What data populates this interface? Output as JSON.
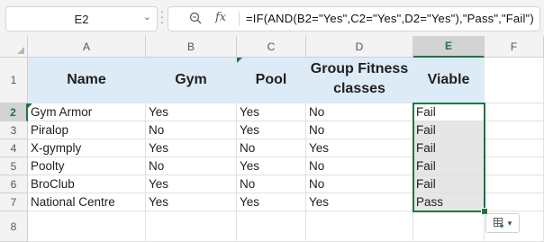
{
  "name_box": {
    "value": "E2"
  },
  "formula_bar": {
    "formula": "=IF(AND(B2=\"Yes\",C2=\"Yes\",D2=\"Yes\"),\"Pass\",\"Fail\")",
    "fx_label": "fx"
  },
  "columns": [
    "A",
    "B",
    "C",
    "D",
    "E",
    "F"
  ],
  "rows": [
    "1",
    "2",
    "3",
    "4",
    "5",
    "6",
    "7",
    "8"
  ],
  "header": {
    "name": "Name",
    "gym": "Gym",
    "pool": "Pool",
    "group": "Group Fitness classes",
    "viable": "Viable"
  },
  "data_rows": [
    {
      "name": "Gym Armor",
      "gym": "Yes",
      "pool": "Yes",
      "group": "No",
      "viable": "Fail"
    },
    {
      "name": "Piralop",
      "gym": "No",
      "pool": "Yes",
      "group": "No",
      "viable": "Fail"
    },
    {
      "name": "X-gymply",
      "gym": "Yes",
      "pool": "No",
      "group": "Yes",
      "viable": "Fail"
    },
    {
      "name": "Poolty",
      "gym": "No",
      "pool": "Yes",
      "group": "No",
      "viable": "Fail"
    },
    {
      "name": "BroClub",
      "gym": "Yes",
      "pool": "No",
      "group": "No",
      "viable": "Fail"
    },
    {
      "name": "National Centre",
      "gym": "Yes",
      "pool": "Yes",
      "group": "Yes",
      "viable": "Pass"
    }
  ],
  "selected_cell": "E2",
  "quick_analysis": {
    "icon": "quick-analysis-icon"
  },
  "colors": {
    "accent": "#217346",
    "header_fill": "#ddebf7",
    "selection_fill": "#e6e6e6"
  }
}
